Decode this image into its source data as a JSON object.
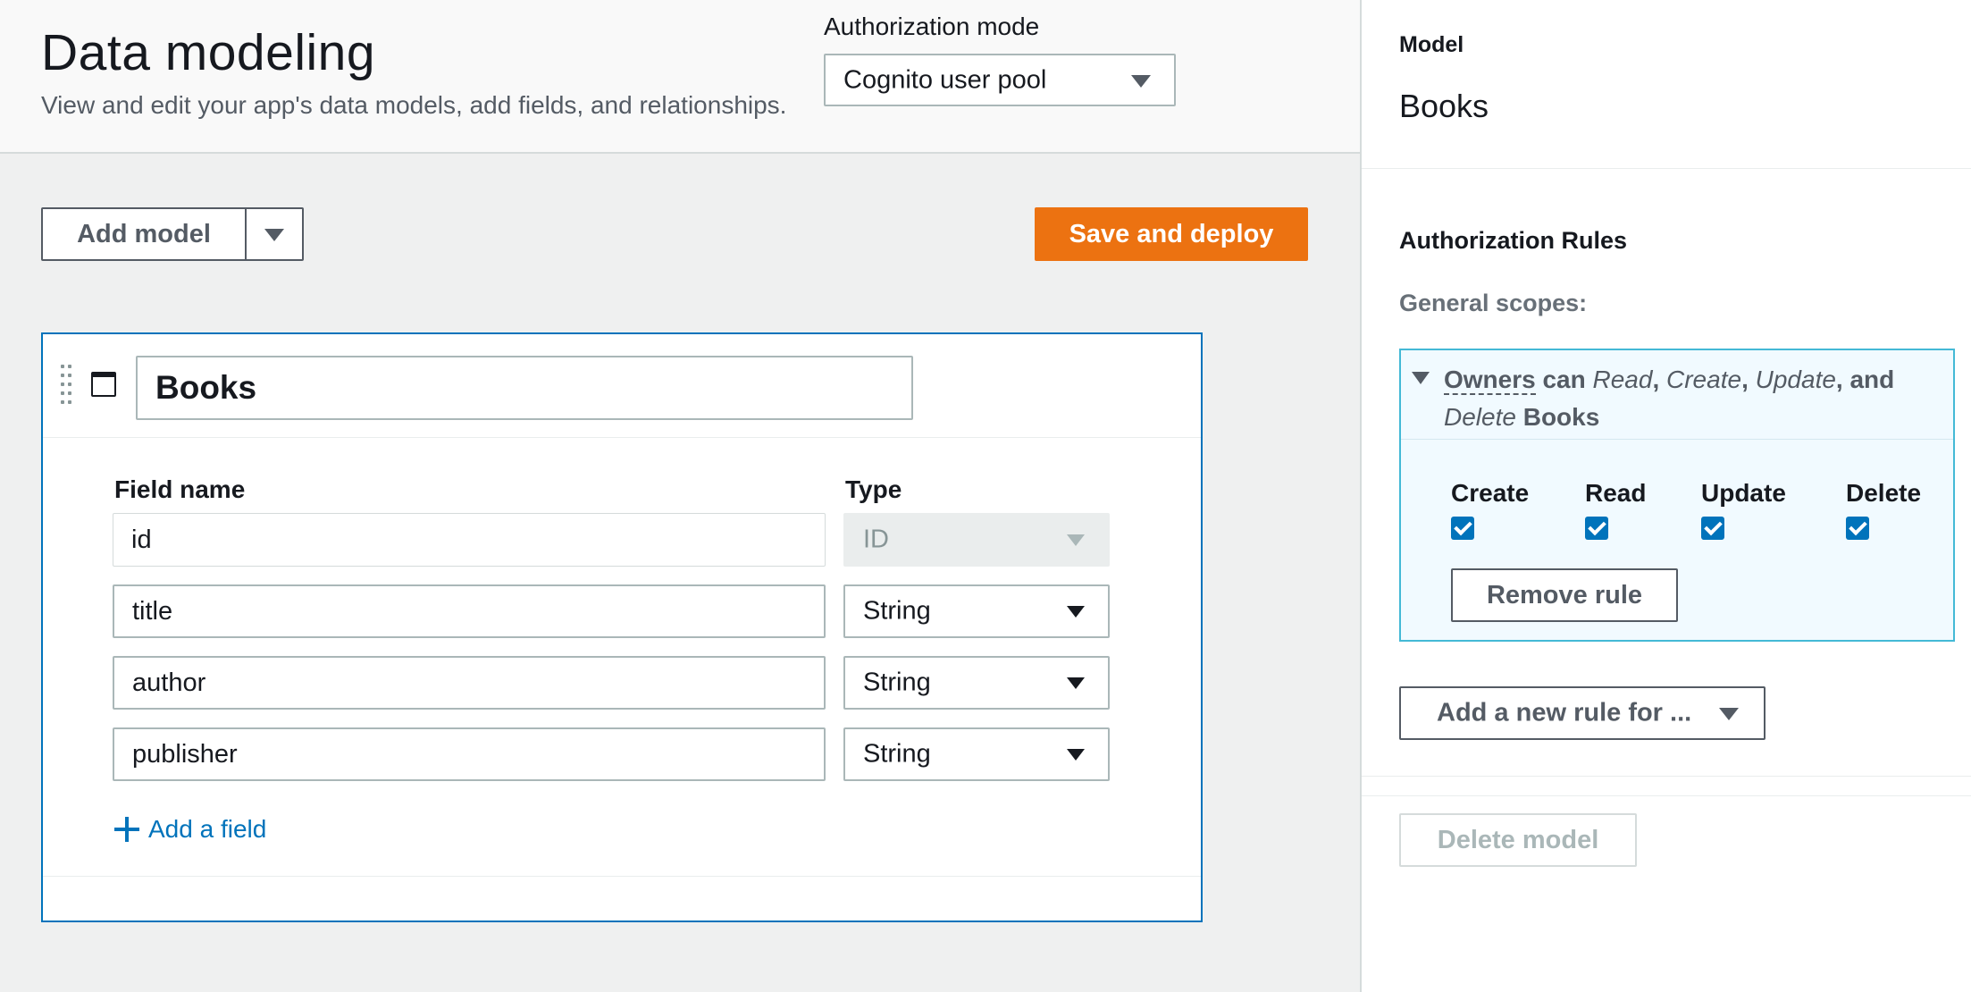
{
  "header": {
    "title": "Data modeling",
    "subtitle": "View and edit your app's data models, add fields, and relationships.",
    "auth_mode_label": "Authorization mode",
    "auth_mode_value": "Cognito user pool"
  },
  "toolbar": {
    "add_model_label": "Add model",
    "save_label": "Save and deploy"
  },
  "model_card": {
    "name": "Books",
    "field_name_header": "Field name",
    "type_header": "Type",
    "fields": [
      {
        "name": "id",
        "type": "ID",
        "editable": false
      },
      {
        "name": "title",
        "type": "String",
        "editable": true
      },
      {
        "name": "author",
        "type": "String",
        "editable": true
      },
      {
        "name": "publisher",
        "type": "String",
        "editable": true
      }
    ],
    "add_field_label": "Add a field"
  },
  "panel": {
    "model_label": "Model",
    "model_name": "Books",
    "rules_title": "Authorization Rules",
    "scopes_label": "General scopes:",
    "rule": {
      "owners": "Owners",
      "can": "can",
      "read": "Read",
      "create": "Create",
      "update": "Update",
      "and": "and",
      "delete": "Delete",
      "model": "Books",
      "permissions": [
        {
          "label": "Create",
          "checked": true
        },
        {
          "label": "Read",
          "checked": true
        },
        {
          "label": "Update",
          "checked": true
        },
        {
          "label": "Delete",
          "checked": true
        }
      ],
      "remove_label": "Remove rule"
    },
    "add_rule_label": "Add a new rule for ...",
    "delete_model_label": "Delete model"
  },
  "colors": {
    "accent_orange": "#ec7211",
    "link_blue": "#0073bb",
    "rule_bg": "#f1faff",
    "rule_border": "#44b9d6"
  }
}
